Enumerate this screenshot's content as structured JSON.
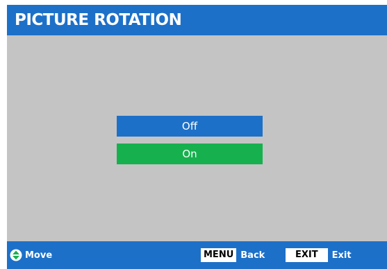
{
  "header": {
    "title": "PICTURE ROTATION"
  },
  "options": {
    "off_label": "Off",
    "on_label": "On"
  },
  "footer": {
    "move_label": "Move",
    "menu_key": "MENU",
    "back_label": "Back",
    "exit_key": "EXIT",
    "exit_label": "Exit"
  },
  "icons": {
    "nav": "up-down-arrows-icon"
  },
  "colors": {
    "header_bar": "#1d70c8",
    "body_background": "#c4c4c4",
    "option_off": "#1d70c8",
    "option_on": "#16b14e",
    "footer_bar": "#1d70c8"
  }
}
